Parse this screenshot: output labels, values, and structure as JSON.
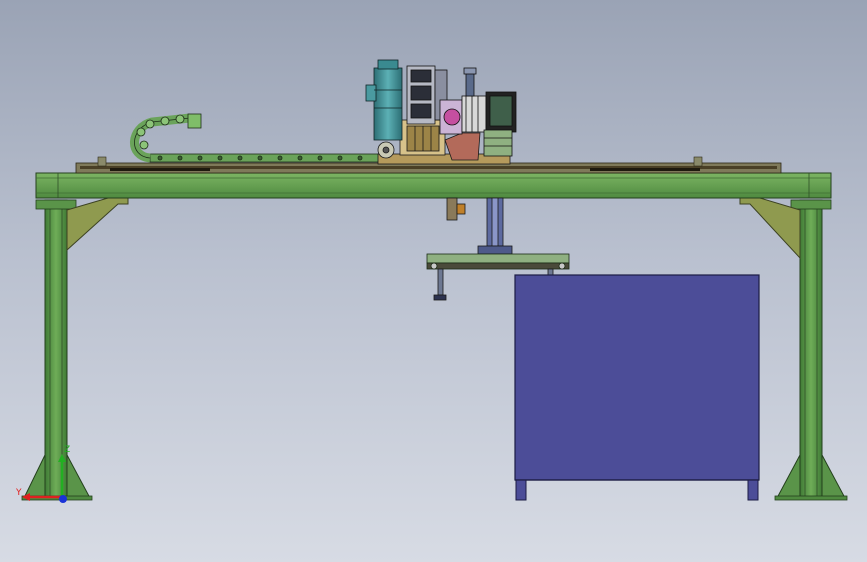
{
  "colors": {
    "frame": "#5f9a4e",
    "frame_dark": "#2f4f27",
    "frame_light": "#7cb563",
    "brace": "#8f9a4f",
    "cabinet": "#4c4d98",
    "cabinet_edge": "#1c1c44",
    "rail": "#4a4026",
    "cable_chain": "#6aa35a",
    "motor_teal": "#3a8a90",
    "gripper": "#8fb081"
  },
  "axes": {
    "x_label": "Y",
    "y_label": "Z",
    "x_color": "#e02020",
    "y_color": "#22b022",
    "z_color": "#1a33d8"
  }
}
